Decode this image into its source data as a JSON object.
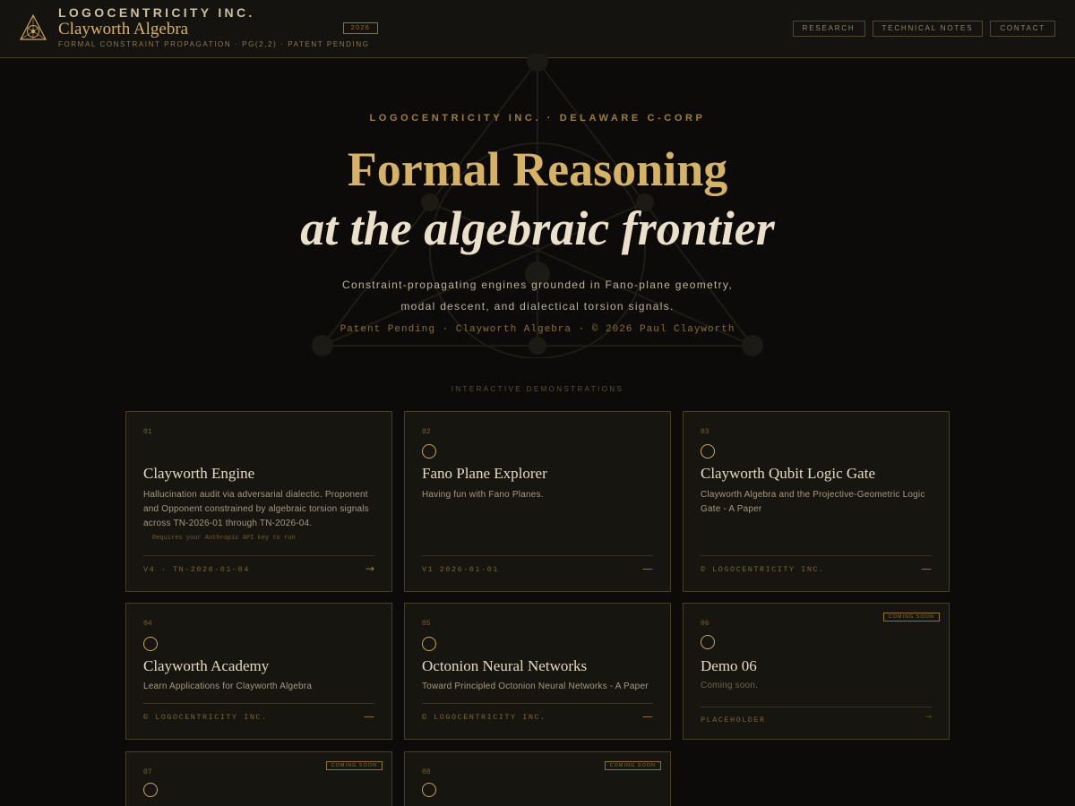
{
  "header": {
    "company": "LOGOCENTRICITY INC.",
    "product": "Clayworth Algebra",
    "tagline": "FORMAL CONSTRAINT PROPAGATION · PG(2,2) · PATENT PENDING",
    "year_badge": "2026",
    "nav": [
      "RESEARCH",
      "TECHNICAL NOTES",
      "CONTACT"
    ]
  },
  "hero": {
    "eyebrow": "LOGOCENTRICITY INC. · DELAWARE C-CORP",
    "title_line1": "Formal Reasoning",
    "title_line2": "at the algebraic frontier",
    "desc_line1": "Constraint-propagating engines grounded in Fano-plane geometry,",
    "desc_line2": "modal descent, and dialectical torsion signals.",
    "meta": "Patent Pending · Clayworth Algebra · © 2026 Paul Clayworth"
  },
  "section_label": "INTERACTIVE DEMONSTRATIONS",
  "cards": [
    {
      "num": "01",
      "title": "Clayworth Engine",
      "desc": "Hallucination audit via adversarial dialectic. Proponent and Opponent constrained by algebraic torsion signals across TN-2026-01 through TN-2026-04.",
      "note": "Requires your Anthropic API key to run",
      "footer": "V4 · TN-2026-01–04",
      "arrow": "→"
    },
    {
      "num": "02",
      "title": "Fano Plane Explorer",
      "desc": "Having fun with Fano Planes.",
      "footer": "V1 2026-01-01",
      "arrow": "—"
    },
    {
      "num": "03",
      "title": "Clayworth Qubit Logic Gate",
      "desc": "Clayworth Algebra and the Projective-Geometric Logic Gate - A Paper",
      "footer": "© LOGOCENTRICITY INC.",
      "arrow": "—"
    },
    {
      "num": "04",
      "title": "Clayworth Academy",
      "desc": "Learn Applications for Clayworth Algebra",
      "footer": "© LOGOCENTRICITY INC.",
      "arrow": "—"
    },
    {
      "num": "05",
      "title": "Octonion Neural Networks",
      "desc": "Toward Principled Octonion Neural Networks - A Paper",
      "footer": "© LOGOCENTRICITY INC.",
      "arrow": "—"
    },
    {
      "num": "06",
      "title": "Demo 06",
      "desc": "Coming soon.",
      "badge": "COMING SOON",
      "footer": "PLACEHOLDER",
      "arrow": "→"
    },
    {
      "num": "07",
      "badge": "COMING SOON"
    },
    {
      "num": "08",
      "badge": "COMING SOON"
    }
  ],
  "colors": {
    "background": "#0c0b09",
    "accent_gold": "#d6b265",
    "border": "#4a3e22"
  },
  "icons": {
    "logo": "fano-triangle-eye-icon",
    "card": "circle-icon"
  }
}
